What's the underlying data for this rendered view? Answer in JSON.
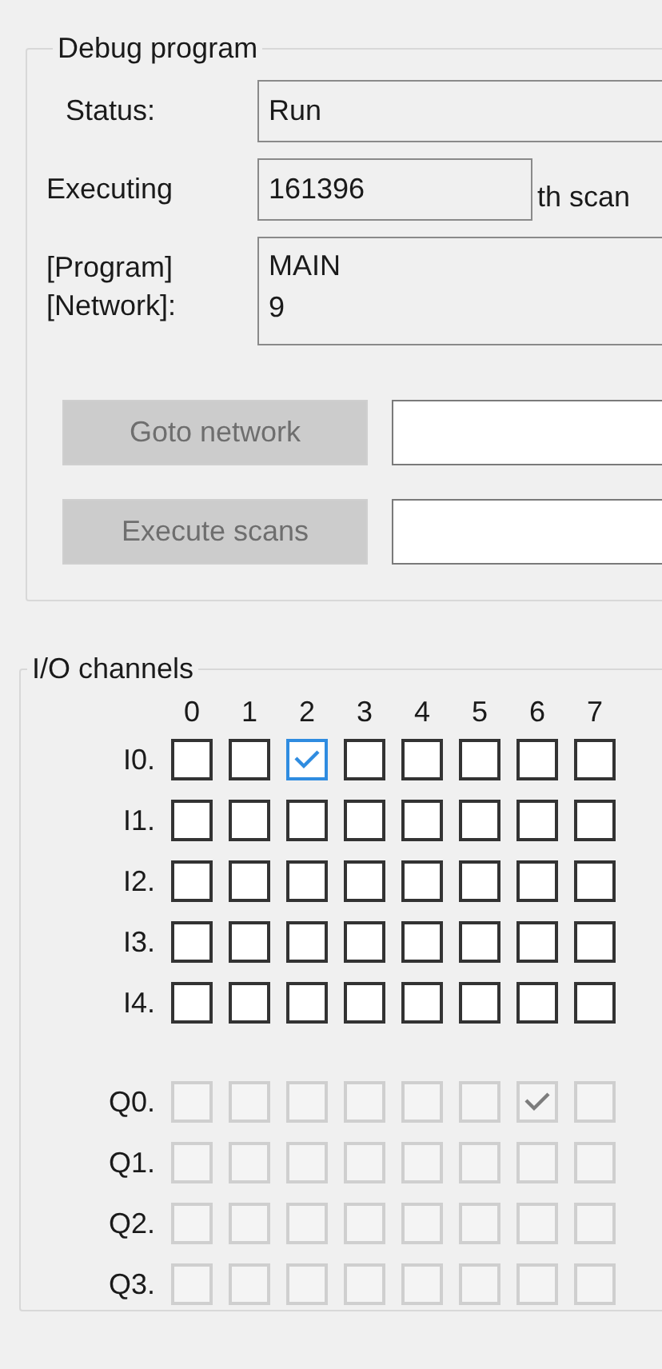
{
  "debug_program": {
    "title": "Debug program",
    "fields": [
      {
        "label": "Status:",
        "value": "Run"
      },
      {
        "label": "Executing",
        "value": "161396",
        "suffix": "th scan"
      },
      {
        "label": "[Program]\n[Network]:",
        "value": "MAIN\n9"
      }
    ],
    "actions": [
      {
        "label": "Goto network",
        "disabled": true
      },
      {
        "label": "Execute scans",
        "disabled": true
      }
    ]
  },
  "io_channels": {
    "title": "I/O channels",
    "columns": [
      "0",
      "1",
      "2",
      "3",
      "4",
      "5",
      "6",
      "7"
    ],
    "groups": [
      {
        "rows": [
          {
            "label": "I0.",
            "disabled": false,
            "bits": [
              {
                "checked": false
              },
              {
                "checked": false
              },
              {
                "checked": true
              },
              {
                "checked": false
              },
              {
                "checked": false
              },
              {
                "checked": false
              },
              {
                "checked": false
              },
              {
                "checked": false
              }
            ]
          },
          {
            "label": "I1.",
            "disabled": false,
            "bits": [
              {
                "checked": false
              },
              {
                "checked": false
              },
              {
                "checked": false
              },
              {
                "checked": false
              },
              {
                "checked": false
              },
              {
                "checked": false
              },
              {
                "checked": false
              },
              {
                "checked": false
              }
            ]
          },
          {
            "label": "I2.",
            "disabled": false,
            "bits": [
              {
                "checked": false
              },
              {
                "checked": false
              },
              {
                "checked": false
              },
              {
                "checked": false
              },
              {
                "checked": false
              },
              {
                "checked": false
              },
              {
                "checked": false
              },
              {
                "checked": false
              }
            ]
          },
          {
            "label": "I3.",
            "disabled": false,
            "bits": [
              {
                "checked": false
              },
              {
                "checked": false
              },
              {
                "checked": false
              },
              {
                "checked": false
              },
              {
                "checked": false
              },
              {
                "checked": false
              },
              {
                "checked": false
              },
              {
                "checked": false
              }
            ]
          },
          {
            "label": "I4.",
            "disabled": false,
            "bits": [
              {
                "checked": false
              },
              {
                "checked": false
              },
              {
                "checked": false
              },
              {
                "checked": false
              },
              {
                "checked": false
              },
              {
                "checked": false
              },
              {
                "checked": false
              },
              {
                "checked": false
              }
            ]
          }
        ]
      },
      {
        "rows": [
          {
            "label": "Q0.",
            "disabled": true,
            "bits": [
              {
                "checked": false
              },
              {
                "checked": false
              },
              {
                "checked": false
              },
              {
                "checked": false
              },
              {
                "checked": false
              },
              {
                "checked": false
              },
              {
                "checked": true
              },
              {
                "checked": false
              }
            ]
          },
          {
            "label": "Q1.",
            "disabled": true,
            "bits": [
              {
                "checked": false
              },
              {
                "checked": false
              },
              {
                "checked": false
              },
              {
                "checked": false
              },
              {
                "checked": false
              },
              {
                "checked": false
              },
              {
                "checked": false
              },
              {
                "checked": false
              }
            ]
          },
          {
            "label": "Q2.",
            "disabled": true,
            "bits": [
              {
                "checked": false
              },
              {
                "checked": false
              },
              {
                "checked": false
              },
              {
                "checked": false
              },
              {
                "checked": false
              },
              {
                "checked": false
              },
              {
                "checked": false
              },
              {
                "checked": false
              }
            ]
          },
          {
            "label": "Q3.",
            "disabled": true,
            "bits": [
              {
                "checked": false
              },
              {
                "checked": false
              },
              {
                "checked": false
              },
              {
                "checked": false
              },
              {
                "checked": false
              },
              {
                "checked": false
              },
              {
                "checked": false
              },
              {
                "checked": false
              }
            ]
          }
        ]
      }
    ]
  }
}
